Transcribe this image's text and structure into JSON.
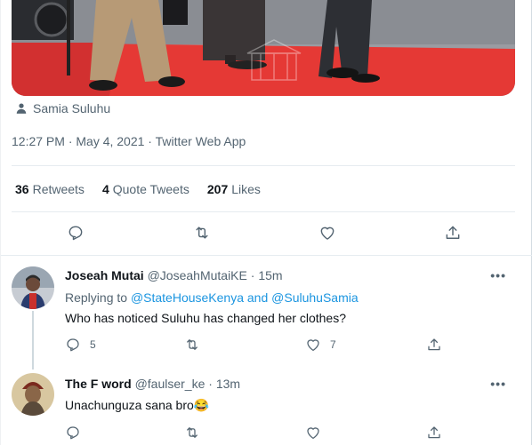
{
  "tweet": {
    "tagged_user": "Samia Suluhu",
    "timestamp": "12:27 PM · May 4, 2021 · Twitter Web App",
    "stats": {
      "retweets_count": "36",
      "retweets_label": "Retweets",
      "quotes_count": "4",
      "quotes_label": "Quote Tweets",
      "likes_count": "207",
      "likes_label": "Likes"
    }
  },
  "replies": [
    {
      "name": "Joseah Mutai",
      "handle": "@JoseahMutaiKE",
      "time": "· 15m",
      "replying_prefix": "Replying to",
      "replying_mentions": "@StateHouseKenya and @SuluhuSamia",
      "text": "Who has noticed Suluhu has changed her clothes?",
      "reply_count": "5",
      "retweet_count": "",
      "like_count": "7",
      "more": "•••"
    },
    {
      "name": "The F word",
      "handle": "@faulser_ke",
      "time": "· 13m",
      "text": "Unachunguza sana bro😂",
      "more": "•••"
    }
  ],
  "colors": {
    "text_primary": "#0f1419",
    "text_secondary": "#536471",
    "link": "#1b95e0",
    "red_carpet": "#e53935"
  },
  "icons": [
    "user-icon",
    "reply-icon",
    "retweet-icon",
    "like-icon",
    "share-icon",
    "more-icon"
  ]
}
